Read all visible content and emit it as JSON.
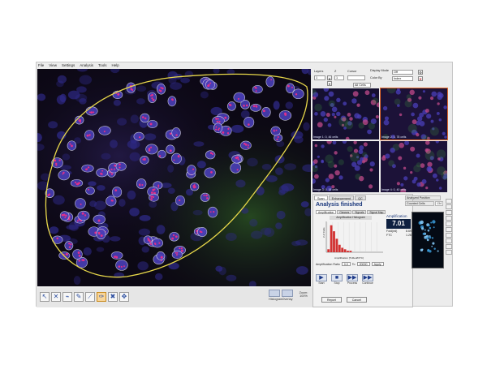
{
  "menu": [
    "File",
    "View",
    "Settings",
    "Analysis",
    "Tools",
    "Help"
  ],
  "controls": {
    "layers_label": "Layers",
    "z_label": "Z",
    "cursor_label": "Cursor",
    "display_mode_label": "Display Mode",
    "display_mode_value": "Off",
    "color_by_label": "Color By",
    "color_by_value": "Index",
    "cell_select_value": "All Cells",
    "stop_icon": "close-x-icon"
  },
  "thumbnails": [
    {
      "label": "Image 1: 0, 46 cells",
      "selected": false
    },
    {
      "label": "Image 2: 0, 78 cells",
      "selected": true
    },
    {
      "label": "Image 3: 0, 18 cells",
      "selected": false
    },
    {
      "label": "Image 4: 0, 40 cells",
      "selected": false
    }
  ],
  "analysis": {
    "tabs": [
      "Scan",
      "Enhancement",
      "QC"
    ],
    "status": "Analysis finished",
    "subtabs": [
      "Amplification",
      "Classes",
      "Signals",
      "Signal Map"
    ],
    "histogram_title": "Amplification Histogram",
    "amplification_label": "Amplification",
    "amplification_value": "7.01",
    "stats": [
      {
        "label": "Fold(ed)",
        "value": "8.69"
      },
      {
        "label": "FTC",
        "value": "1.26"
      }
    ],
    "range_label": "Amplification Ratio",
    "range_from": "0.0",
    "range_to_label": "To",
    "range_to": "20000",
    "apply_label": "Apply",
    "media_buttons": [
      {
        "glyph": "▶",
        "label": "Start",
        "icon": "play-icon"
      },
      {
        "glyph": "■",
        "label": "Stop",
        "icon": "stop-icon"
      },
      {
        "glyph": "▶▶",
        "label": "Process",
        "icon": "fast-forward-icon"
      },
      {
        "glyph": "▶▶",
        "label": "Continue",
        "icon": "fast-forward-icon"
      }
    ],
    "buttons": [
      "Report",
      "Cancel"
    ],
    "analyzed_position_label": "Analyzed Position",
    "counted_cells_label": "Counted Cells",
    "counted_cells_value": "134"
  },
  "bottom_tools": [
    {
      "icon": "select-arrow-icon",
      "glyph": "↖",
      "active": false
    },
    {
      "icon": "close-x-icon",
      "glyph": "✕",
      "active": false
    },
    {
      "icon": "measure-icon",
      "glyph": "⌁",
      "active": false
    },
    {
      "icon": "pen-icon",
      "glyph": "✎",
      "active": false
    },
    {
      "icon": "brush-icon",
      "glyph": "⟋",
      "active": false
    },
    {
      "icon": "draw-region-icon",
      "glyph": "✑",
      "active": true
    },
    {
      "icon": "delete-icon",
      "glyph": "✖",
      "active": false
    },
    {
      "icon": "move-icon",
      "glyph": "✥",
      "active": false
    }
  ],
  "view_buttons": [
    {
      "icon": "histogram-view-icon",
      "label": "Histogram"
    },
    {
      "icon": "overlay-view-icon",
      "label": "Overlay"
    }
  ],
  "zoom_label": "Zoom:",
  "zoom_value": "100%",
  "chart_data": {
    "type": "bar",
    "title": "Amplification Histogram",
    "xlabel": "Amplification [TxRed/FITC]",
    "ylabel": "# of Cells",
    "series": [
      {
        "values": [
          2,
          18,
          14,
          9,
          5,
          3,
          2,
          1,
          1,
          0,
          0,
          0,
          0,
          0,
          0,
          0,
          0,
          0,
          0,
          0
        ]
      }
    ],
    "ylim": [
      0,
      20
    ],
    "colors": {
      "bars": "#d23030"
    }
  },
  "colors": {
    "region_outline": "#e8d84a",
    "nucleus_fill": "#4a3fb8",
    "nucleus_outline": "#d8d8e8",
    "signal_red": "#e0308a",
    "tissue_green": "#2f6a2a",
    "accent_title": "#17357a"
  }
}
